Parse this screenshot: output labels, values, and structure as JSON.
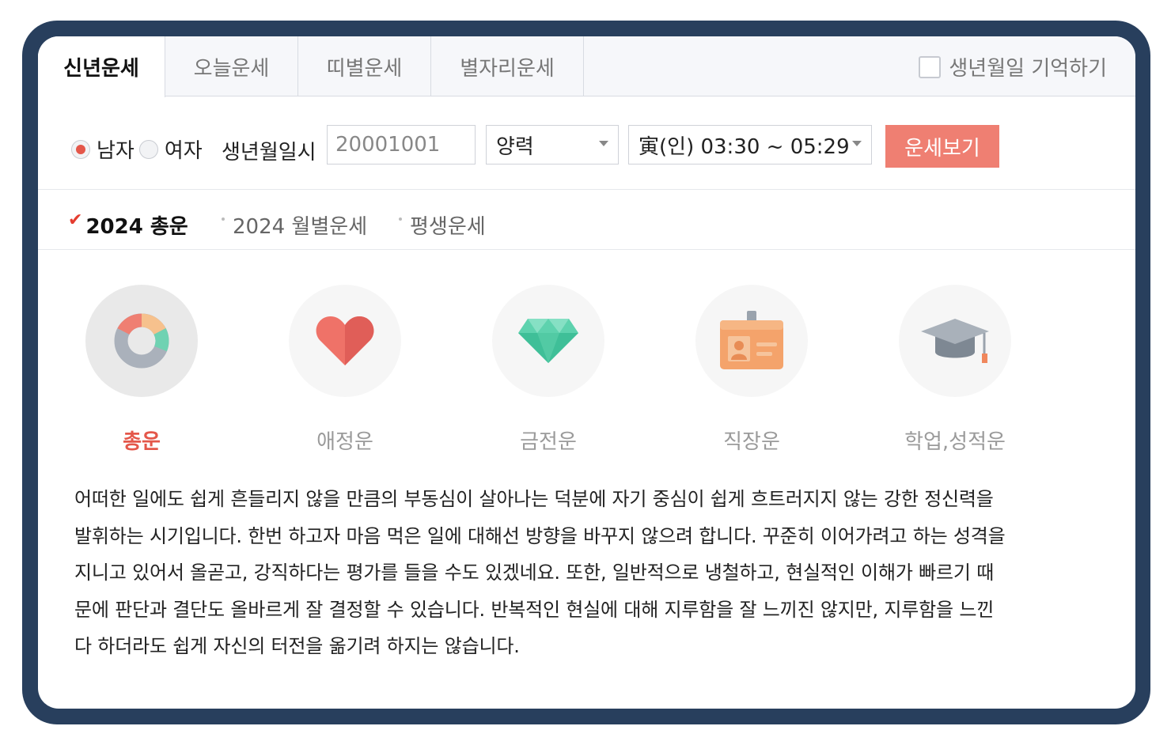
{
  "tabs": [
    {
      "label": "신년운세",
      "active": true
    },
    {
      "label": "오늘운세",
      "active": false
    },
    {
      "label": "띠별운세",
      "active": false
    },
    {
      "label": "별자리운세",
      "active": false
    }
  ],
  "remember_label": "생년월일 기억하기",
  "form": {
    "gender_male": "남자",
    "gender_female": "여자",
    "dob_label": "생년월일시",
    "dob_value": "20001001",
    "calendar_value": "양력",
    "time_value": "寅(인) 03:30 ~ 05:29",
    "submit_label": "운세보기"
  },
  "subtabs": [
    {
      "label": "2024 총운",
      "active": true
    },
    {
      "label": "2024 월별운세",
      "active": false
    },
    {
      "label": "평생운세",
      "active": false
    }
  ],
  "categories": [
    {
      "label": "총운",
      "icon": "donut-chart-icon",
      "active": true
    },
    {
      "label": "애정운",
      "icon": "heart-icon",
      "active": false
    },
    {
      "label": "금전운",
      "icon": "diamond-icon",
      "active": false
    },
    {
      "label": "직장운",
      "icon": "id-badge-icon",
      "active": false
    },
    {
      "label": "학업,성적운",
      "icon": "graduation-cap-icon",
      "active": false
    }
  ],
  "description": [
    "어떠한 일에도 쉽게 흔들리지 않을 만큼의 부동심이 살아나는 덕분에 자기 중심이 쉽게 흐트러지지 않는 강한 정신력을",
    "발휘하는 시기입니다. 한번 하고자 마음 먹은 일에 대해선 방향을 바꾸지 않으려 합니다. 꾸준히 이어가려고 하는 성격을",
    "지니고 있어서 올곧고, 강직하다는 평가를 들을 수도 있겠네요. 또한, 일반적으로 냉철하고, 현실적인 이해가 빠르기 때",
    "문에 판단과 결단도 올바르게 잘 결정할 수 있습니다. 반복적인 현실에 대해 지루함을 잘 느끼진 않지만, 지루함을 느낀",
    "다 하더라도 쉽게 자신의 터전을 옮기려 하지는 않습니다."
  ],
  "colors": {
    "frame": "#283f5d",
    "accent": "#e4574a",
    "button": "#ef7f72"
  }
}
